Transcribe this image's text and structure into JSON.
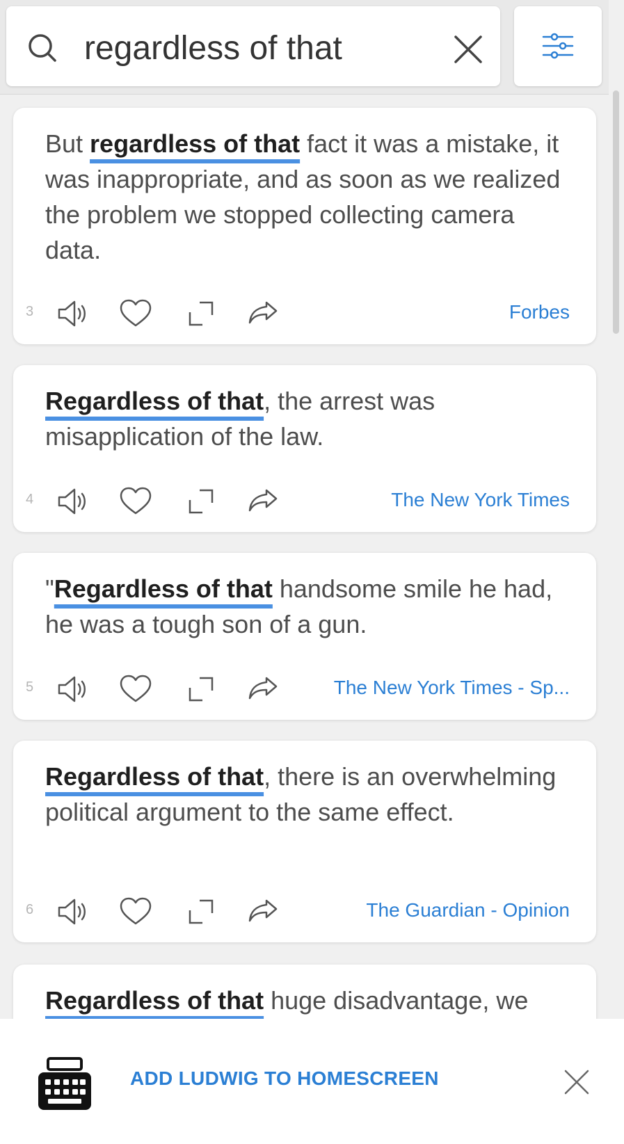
{
  "search": {
    "value": "regardless of that",
    "icon": "search-icon",
    "clear_icon": "close-icon",
    "filter_icon": "sliders-icon"
  },
  "colors": {
    "accent": "#4a90e2",
    "link": "#2b7fd4",
    "background": "#f0f0f0"
  },
  "results": [
    {
      "number": "3",
      "before": "But ",
      "highlight": "regardless of that",
      "after": " fact it was a mistake, it was inappropriate, and as soon as we realized the problem we stopped collecting camera data.",
      "source": "Forbes"
    },
    {
      "number": "4",
      "before": "",
      "highlight": "Regardless of that",
      "after": ", the arrest was misapplication of the law.",
      "source": "The New York Times"
    },
    {
      "number": "5",
      "before": "\"",
      "highlight": "Regardless of that",
      "after": " handsome smile he had, he was a tough son of a gun.",
      "source": "The New York Times - Sp..."
    },
    {
      "number": "6",
      "before": "",
      "highlight": "Regardless of that",
      "after": ", there is an overwhelming political argument to the same effect.",
      "source": "The Guardian - Opinion"
    },
    {
      "number": "",
      "before": "",
      "highlight": "Regardless of that",
      "after": " huge disadvantage, we",
      "source": ""
    }
  ],
  "action_icons": [
    "speaker-icon",
    "heart-icon",
    "expand-icon",
    "share-icon"
  ],
  "banner": {
    "text": "ADD LUDWIG TO HOMESCREEN",
    "icon": "keyboard-icon",
    "close_icon": "close-icon"
  }
}
